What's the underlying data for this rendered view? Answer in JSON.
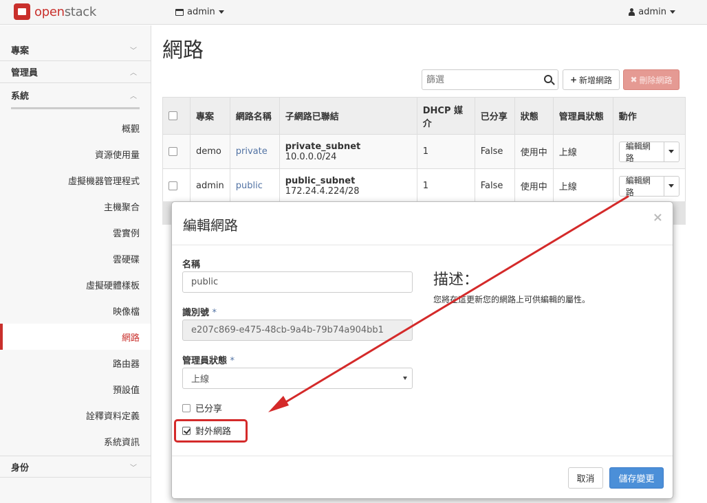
{
  "topbar": {
    "logo_text_prefix": "open",
    "logo_text_suffix": "stack",
    "project": "admin",
    "user": "admin"
  },
  "sidebar": {
    "sections": {
      "project": "專案",
      "admin": "管理員",
      "identity": "身份"
    },
    "system_label": "系統",
    "items": [
      "概觀",
      "資源使用量",
      "虛擬機器管理程式",
      "主機聚合",
      "雲實例",
      "雲硬碟",
      "虛擬硬體樣板",
      "映像檔",
      "網路",
      "路由器",
      "預設值",
      "詮釋資料定義",
      "系統資訊"
    ],
    "active_index": 8
  },
  "main": {
    "title": "網路",
    "filter_placeholder": "篩選",
    "add_button": "新增網路",
    "delete_button": "刪除網路",
    "table": {
      "headers": [
        "",
        "專案",
        "網路名稱",
        "子網路已聯結",
        "DHCP 媒介",
        "已分享",
        "狀態",
        "管理員狀態",
        "動作"
      ],
      "rows": [
        {
          "project": "demo",
          "name": "private",
          "subnet_name": "private_subnet",
          "subnet_cidr": "10.0.0.0/24",
          "dhcp": "1",
          "shared": "False",
          "status": "使用中",
          "admin_state": "上線",
          "action": "編輯網路"
        },
        {
          "project": "admin",
          "name": "public",
          "subnet_name": "public_subnet",
          "subnet_cidr": "172.24.4.224/28",
          "dhcp": "1",
          "shared": "False",
          "status": "使用中",
          "admin_state": "上線",
          "action": "編輯網路"
        }
      ]
    }
  },
  "modal": {
    "title": "編輯網路",
    "close": "×",
    "name_label": "名稱",
    "name_value": "public",
    "id_label": "識別號",
    "required_mark": "*",
    "id_value": "e207c869-e475-48cb-9a4b-79b74a904bb1",
    "admin_state_label": "管理員狀態",
    "admin_state_value": "上線",
    "shared_label": "已分享",
    "shared_checked": false,
    "external_label": "對外網路",
    "external_checked": true,
    "desc_title": "描述：",
    "desc_text": "您將在這更新您的網路上可供編輯的屬性。",
    "cancel_button": "取消",
    "save_button": "儲存變更"
  },
  "colors": {
    "accent_red": "#c9302c",
    "link_blue": "#5273a4",
    "primary_blue": "#4b8fd8",
    "annotation_red": "#d42a2a"
  }
}
